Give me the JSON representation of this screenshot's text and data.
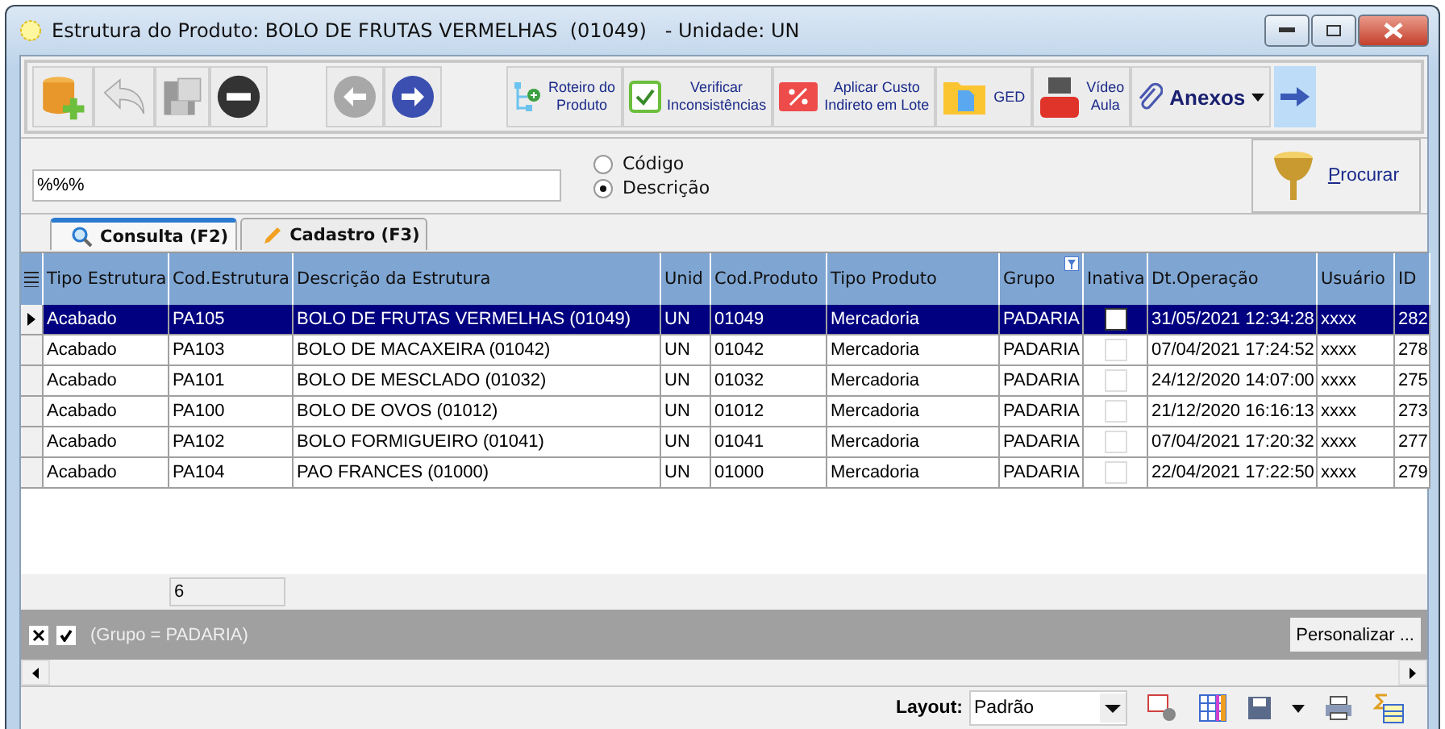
{
  "window": {
    "title": "Estrutura do Produto: BOLO DE FRUTAS VERMELHAS  (01049)   - Unidade: UN"
  },
  "toolbar": [
    {
      "kind": "add"
    },
    {
      "kind": "undo",
      "disabled": true
    },
    {
      "kind": "save",
      "disabled": true
    },
    {
      "kind": "remove"
    },
    {
      "kind": "back",
      "disabled": true
    },
    {
      "kind": "forward"
    },
    {
      "kind": "route",
      "label": "Roteiro do\nProduto"
    },
    {
      "kind": "check",
      "label": "Verificar\nInconsistências"
    },
    {
      "kind": "percent",
      "label": "Aplicar Custo\nIndireto em Lote"
    },
    {
      "kind": "folder",
      "label": "GED"
    },
    {
      "kind": "video",
      "label": "Vídeo\nAula"
    },
    {
      "kind": "attach",
      "label": "Anexos"
    },
    {
      "kind": "next"
    }
  ],
  "search": {
    "value": "%%%",
    "options": [
      {
        "label": "Código",
        "selected": false
      },
      {
        "label": "Descrição",
        "selected": true
      }
    ],
    "button": "Procurar"
  },
  "tabs": [
    {
      "label": "Consulta (F2)",
      "kind": "search",
      "selected": true
    },
    {
      "label": "Cadastro (F3)",
      "kind": "pencil",
      "selected": false
    }
  ],
  "table": {
    "columns": [
      "Tipo Estrutura",
      "Cod.Estrutura",
      "Descrição da Estrutura",
      "Unid",
      "Cod.Produto",
      "Tipo Produto",
      "Grupo",
      "Inativa",
      "Dt.Operação",
      "Usuário",
      "ID"
    ],
    "rows": [
      {
        "selected": true,
        "inativa": false,
        "cells": [
          "Acabado",
          "PA105",
          "BOLO DE FRUTAS VERMELHAS  (01049)",
          "UN",
          "01049",
          "Mercadoria",
          "PADARIA",
          "",
          "31/05/2021 12:34:28",
          "xxxx",
          "282"
        ]
      },
      {
        "selected": false,
        "inativa": false,
        "cells": [
          "Acabado",
          "PA103",
          "BOLO DE MACAXEIRA  (01042)",
          "UN",
          "01042",
          "Mercadoria",
          "PADARIA",
          "",
          "07/04/2021 17:24:52",
          "xxxx",
          "278"
        ]
      },
      {
        "selected": false,
        "inativa": false,
        "cells": [
          "Acabado",
          "PA101",
          "BOLO DE MESCLADO  (01032)",
          "UN",
          "01032",
          "Mercadoria",
          "PADARIA",
          "",
          "24/12/2020 14:07:00",
          "xxxx",
          "275"
        ]
      },
      {
        "selected": false,
        "inativa": false,
        "cells": [
          "Acabado",
          "PA100",
          "BOLO DE OVOS  (01012)",
          "UN",
          "01012",
          "Mercadoria",
          "PADARIA",
          "",
          "21/12/2020 16:16:13",
          "xxxx",
          "273"
        ]
      },
      {
        "selected": false,
        "inativa": false,
        "cells": [
          "Acabado",
          "PA102",
          "BOLO FORMIGUEIRO  (01041)",
          "UN",
          "01041",
          "Mercadoria",
          "PADARIA",
          "",
          "07/04/2021 17:20:32",
          "xxxx",
          "277"
        ]
      },
      {
        "selected": false,
        "inativa": false,
        "cells": [
          "Acabado",
          "PA104",
          "PAO FRANCES  (01000)",
          "UN",
          "01000",
          "Mercadoria",
          "PADARIA",
          "",
          "22/04/2021 17:22:50",
          "xxxx",
          "279"
        ]
      }
    ],
    "count": "6"
  },
  "filter": {
    "enabled": true,
    "text": "(Grupo = PADARIA)",
    "button": "Personalizar ..."
  },
  "bottom": {
    "label": "Layout:",
    "value": "Padrão"
  }
}
